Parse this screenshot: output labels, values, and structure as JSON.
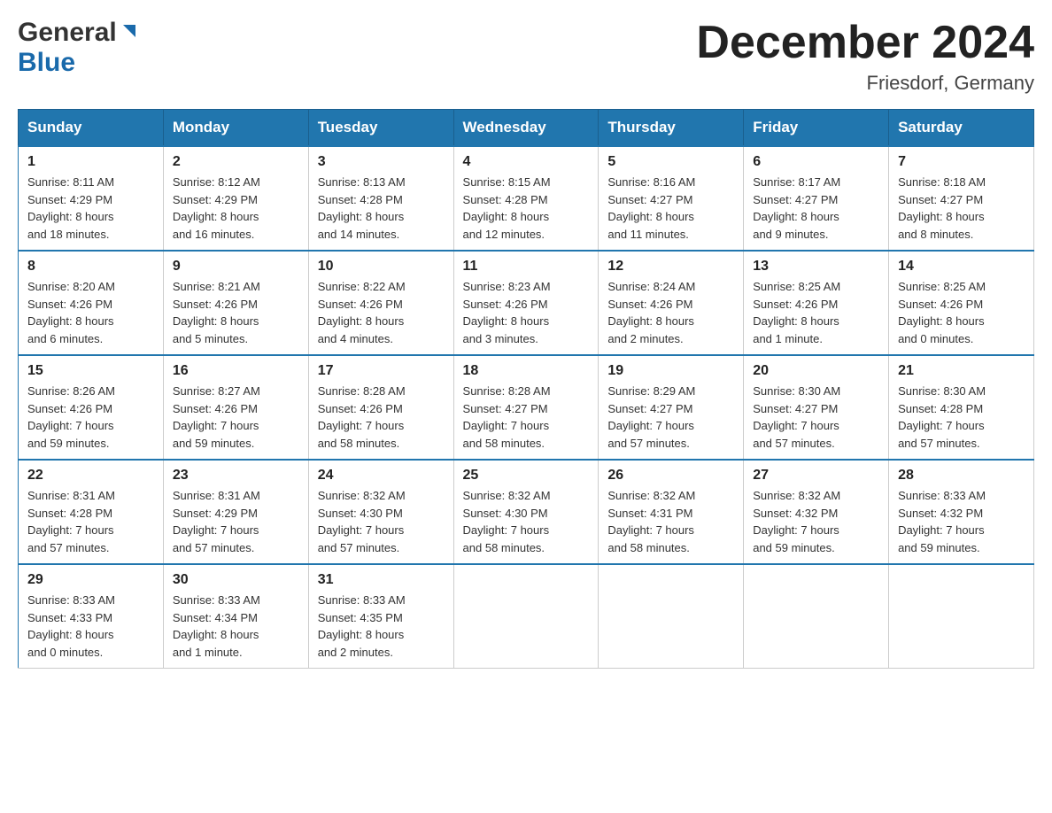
{
  "header": {
    "logo_general": "General",
    "logo_blue": "Blue",
    "month_title": "December 2024",
    "location": "Friesdorf, Germany"
  },
  "days_of_week": [
    "Sunday",
    "Monday",
    "Tuesday",
    "Wednesday",
    "Thursday",
    "Friday",
    "Saturday"
  ],
  "weeks": [
    [
      {
        "day": "1",
        "sunrise": "8:11 AM",
        "sunset": "4:29 PM",
        "daylight": "8 hours and 18 minutes."
      },
      {
        "day": "2",
        "sunrise": "8:12 AM",
        "sunset": "4:29 PM",
        "daylight": "8 hours and 16 minutes."
      },
      {
        "day": "3",
        "sunrise": "8:13 AM",
        "sunset": "4:28 PM",
        "daylight": "8 hours and 14 minutes."
      },
      {
        "day": "4",
        "sunrise": "8:15 AM",
        "sunset": "4:28 PM",
        "daylight": "8 hours and 12 minutes."
      },
      {
        "day": "5",
        "sunrise": "8:16 AM",
        "sunset": "4:27 PM",
        "daylight": "8 hours and 11 minutes."
      },
      {
        "day": "6",
        "sunrise": "8:17 AM",
        "sunset": "4:27 PM",
        "daylight": "8 hours and 9 minutes."
      },
      {
        "day": "7",
        "sunrise": "8:18 AM",
        "sunset": "4:27 PM",
        "daylight": "8 hours and 8 minutes."
      }
    ],
    [
      {
        "day": "8",
        "sunrise": "8:20 AM",
        "sunset": "4:26 PM",
        "daylight": "8 hours and 6 minutes."
      },
      {
        "day": "9",
        "sunrise": "8:21 AM",
        "sunset": "4:26 PM",
        "daylight": "8 hours and 5 minutes."
      },
      {
        "day": "10",
        "sunrise": "8:22 AM",
        "sunset": "4:26 PM",
        "daylight": "8 hours and 4 minutes."
      },
      {
        "day": "11",
        "sunrise": "8:23 AM",
        "sunset": "4:26 PM",
        "daylight": "8 hours and 3 minutes."
      },
      {
        "day": "12",
        "sunrise": "8:24 AM",
        "sunset": "4:26 PM",
        "daylight": "8 hours and 2 minutes."
      },
      {
        "day": "13",
        "sunrise": "8:25 AM",
        "sunset": "4:26 PM",
        "daylight": "8 hours and 1 minute."
      },
      {
        "day": "14",
        "sunrise": "8:25 AM",
        "sunset": "4:26 PM",
        "daylight": "8 hours and 0 minutes."
      }
    ],
    [
      {
        "day": "15",
        "sunrise": "8:26 AM",
        "sunset": "4:26 PM",
        "daylight": "7 hours and 59 minutes."
      },
      {
        "day": "16",
        "sunrise": "8:27 AM",
        "sunset": "4:26 PM",
        "daylight": "7 hours and 59 minutes."
      },
      {
        "day": "17",
        "sunrise": "8:28 AM",
        "sunset": "4:26 PM",
        "daylight": "7 hours and 58 minutes."
      },
      {
        "day": "18",
        "sunrise": "8:28 AM",
        "sunset": "4:27 PM",
        "daylight": "7 hours and 58 minutes."
      },
      {
        "day": "19",
        "sunrise": "8:29 AM",
        "sunset": "4:27 PM",
        "daylight": "7 hours and 57 minutes."
      },
      {
        "day": "20",
        "sunrise": "8:30 AM",
        "sunset": "4:27 PM",
        "daylight": "7 hours and 57 minutes."
      },
      {
        "day": "21",
        "sunrise": "8:30 AM",
        "sunset": "4:28 PM",
        "daylight": "7 hours and 57 minutes."
      }
    ],
    [
      {
        "day": "22",
        "sunrise": "8:31 AM",
        "sunset": "4:28 PM",
        "daylight": "7 hours and 57 minutes."
      },
      {
        "day": "23",
        "sunrise": "8:31 AM",
        "sunset": "4:29 PM",
        "daylight": "7 hours and 57 minutes."
      },
      {
        "day": "24",
        "sunrise": "8:32 AM",
        "sunset": "4:30 PM",
        "daylight": "7 hours and 57 minutes."
      },
      {
        "day": "25",
        "sunrise": "8:32 AM",
        "sunset": "4:30 PM",
        "daylight": "7 hours and 58 minutes."
      },
      {
        "day": "26",
        "sunrise": "8:32 AM",
        "sunset": "4:31 PM",
        "daylight": "7 hours and 58 minutes."
      },
      {
        "day": "27",
        "sunrise": "8:32 AM",
        "sunset": "4:32 PM",
        "daylight": "7 hours and 59 minutes."
      },
      {
        "day": "28",
        "sunrise": "8:33 AM",
        "sunset": "4:32 PM",
        "daylight": "7 hours and 59 minutes."
      }
    ],
    [
      {
        "day": "29",
        "sunrise": "8:33 AM",
        "sunset": "4:33 PM",
        "daylight": "8 hours and 0 minutes."
      },
      {
        "day": "30",
        "sunrise": "8:33 AM",
        "sunset": "4:34 PM",
        "daylight": "8 hours and 1 minute."
      },
      {
        "day": "31",
        "sunrise": "8:33 AM",
        "sunset": "4:35 PM",
        "daylight": "8 hours and 2 minutes."
      },
      null,
      null,
      null,
      null
    ]
  ],
  "labels": {
    "sunrise": "Sunrise:",
    "sunset": "Sunset:",
    "daylight": "Daylight:"
  }
}
